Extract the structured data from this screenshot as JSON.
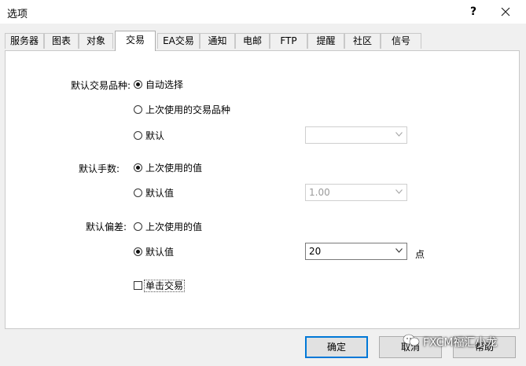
{
  "window": {
    "title": "选项",
    "help_glyph": "?"
  },
  "tabs": [
    {
      "label": "服务器"
    },
    {
      "label": "图表"
    },
    {
      "label": "对象"
    },
    {
      "label": "交易",
      "active": true
    },
    {
      "label": "EA交易"
    },
    {
      "label": "通知"
    },
    {
      "label": "电邮"
    },
    {
      "label": "FTP"
    },
    {
      "label": "提醒"
    },
    {
      "label": "社区"
    },
    {
      "label": "信号"
    }
  ],
  "trade": {
    "symbol_group": {
      "label": "默认交易品种:",
      "options": [
        {
          "label": "自动选择",
          "checked": true
        },
        {
          "label": "上次使用的交易品种",
          "checked": false
        },
        {
          "label": "默认",
          "checked": false
        }
      ],
      "default_combo_value": ""
    },
    "lots_group": {
      "label": "默认手数:",
      "options": [
        {
          "label": "上次使用的值",
          "checked": true
        },
        {
          "label": "默认值",
          "checked": false
        }
      ],
      "default_combo_value": "1.00"
    },
    "deviation_group": {
      "label": "默认偏差:",
      "options": [
        {
          "label": "上次使用的值",
          "checked": false
        },
        {
          "label": "默认值",
          "checked": true
        }
      ],
      "default_combo_value": "20",
      "unit": "点"
    },
    "one_click": {
      "label": "单击交易",
      "checked": false
    }
  },
  "buttons": {
    "ok": "确定",
    "cancel": "取消",
    "help": "帮助"
  },
  "watermark": {
    "text": "FXCM福汇小龙"
  },
  "icons": {
    "help": "question-mark-icon",
    "close": "close-icon",
    "dropdown": "chevron-down-icon",
    "watermark": "wechat-icon"
  },
  "colors": {
    "default_button_border": "#0078d7",
    "panel_bg": "#ffffff",
    "window_bg": "#f0f0f0"
  }
}
